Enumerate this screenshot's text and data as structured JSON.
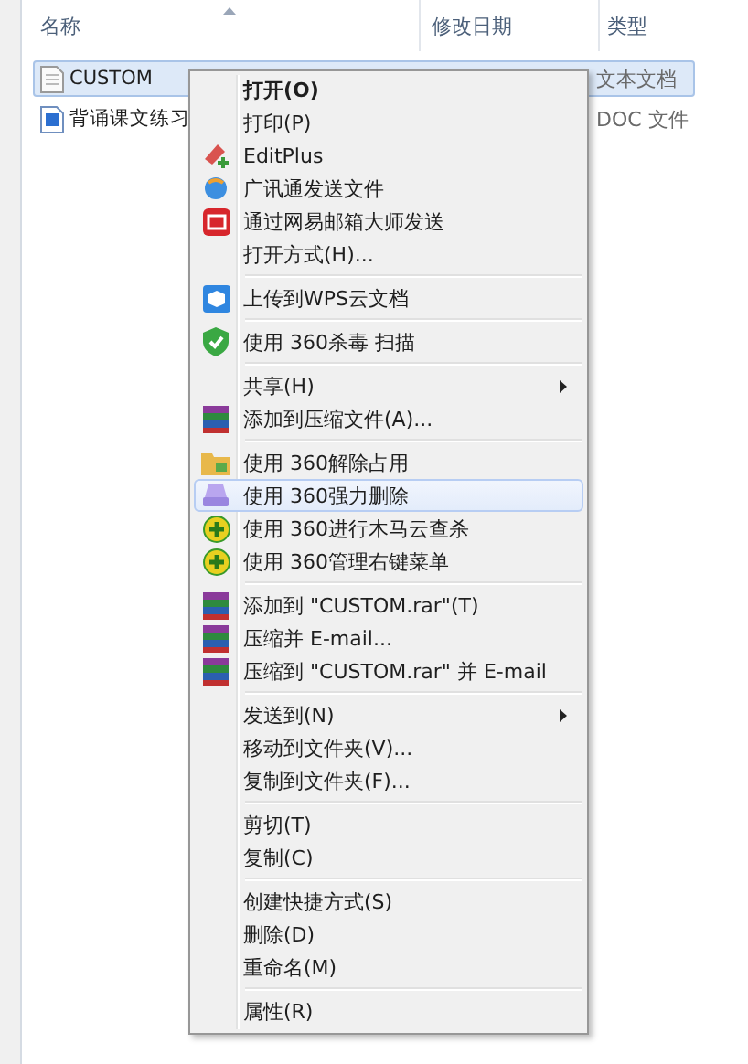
{
  "columns": [
    {
      "label": "名称"
    },
    {
      "label": "修改日期"
    },
    {
      "label": "类型"
    }
  ],
  "files": [
    {
      "name": "CUSTOM",
      "type": "文本文档",
      "selected": true
    },
    {
      "name": "背诵课文练习",
      "type": "DOC 文件",
      "selected": false
    }
  ],
  "context_menu": {
    "groups": [
      [
        {
          "label": "打开(O)",
          "default": true,
          "selected": false,
          "submenu": false
        },
        {
          "label": "打印(P)",
          "default": false,
          "selected": false,
          "submenu": false
        },
        {
          "label": "EditPlus",
          "default": false,
          "selected": false,
          "submenu": false
        },
        {
          "label": "广讯通发送文件",
          "default": false,
          "selected": false,
          "submenu": false
        },
        {
          "label": "通过网易邮箱大师发送",
          "default": false,
          "selected": false,
          "submenu": false
        },
        {
          "label": "打开方式(H)...",
          "default": false,
          "selected": false,
          "submenu": false
        }
      ],
      [
        {
          "label": "上传到WPS云文档",
          "default": false,
          "selected": false,
          "submenu": false
        }
      ],
      [
        {
          "label": "使用 360杀毒 扫描",
          "default": false,
          "selected": false,
          "submenu": false
        }
      ],
      [
        {
          "label": "共享(H)",
          "default": false,
          "selected": false,
          "submenu": true
        },
        {
          "label": "添加到压缩文件(A)...",
          "default": false,
          "selected": false,
          "submenu": false
        }
      ],
      [
        {
          "label": "使用 360解除占用",
          "default": false,
          "selected": false,
          "submenu": false
        },
        {
          "label": "使用 360强力删除",
          "default": false,
          "selected": true,
          "submenu": false
        },
        {
          "label": "使用 360进行木马云查杀",
          "default": false,
          "selected": false,
          "submenu": false
        },
        {
          "label": "使用 360管理右键菜单",
          "default": false,
          "selected": false,
          "submenu": false
        }
      ],
      [
        {
          "label": "添加到 \"CUSTOM.rar\"(T)",
          "default": false,
          "selected": false,
          "submenu": false
        },
        {
          "label": "压缩并 E-mail...",
          "default": false,
          "selected": false,
          "submenu": false
        },
        {
          "label": "压缩到 \"CUSTOM.rar\" 并 E-mail",
          "default": false,
          "selected": false,
          "submenu": false
        }
      ],
      [
        {
          "label": "发送到(N)",
          "default": false,
          "selected": false,
          "submenu": true
        },
        {
          "label": "移动到文件夹(V)...",
          "default": false,
          "selected": false,
          "submenu": false
        },
        {
          "label": "复制到文件夹(F)...",
          "default": false,
          "selected": false,
          "submenu": false
        }
      ],
      [
        {
          "label": "剪切(T)",
          "default": false,
          "selected": false,
          "submenu": false
        },
        {
          "label": "复制(C)",
          "default": false,
          "selected": false,
          "submenu": false
        }
      ],
      [
        {
          "label": "创建快捷方式(S)",
          "default": false,
          "selected": false,
          "submenu": false
        },
        {
          "label": "删除(D)",
          "default": false,
          "selected": false,
          "submenu": false
        },
        {
          "label": "重命名(M)",
          "default": false,
          "selected": false,
          "submenu": false
        }
      ],
      [
        {
          "label": "属性(R)",
          "default": false,
          "selected": false,
          "submenu": false
        }
      ]
    ]
  }
}
